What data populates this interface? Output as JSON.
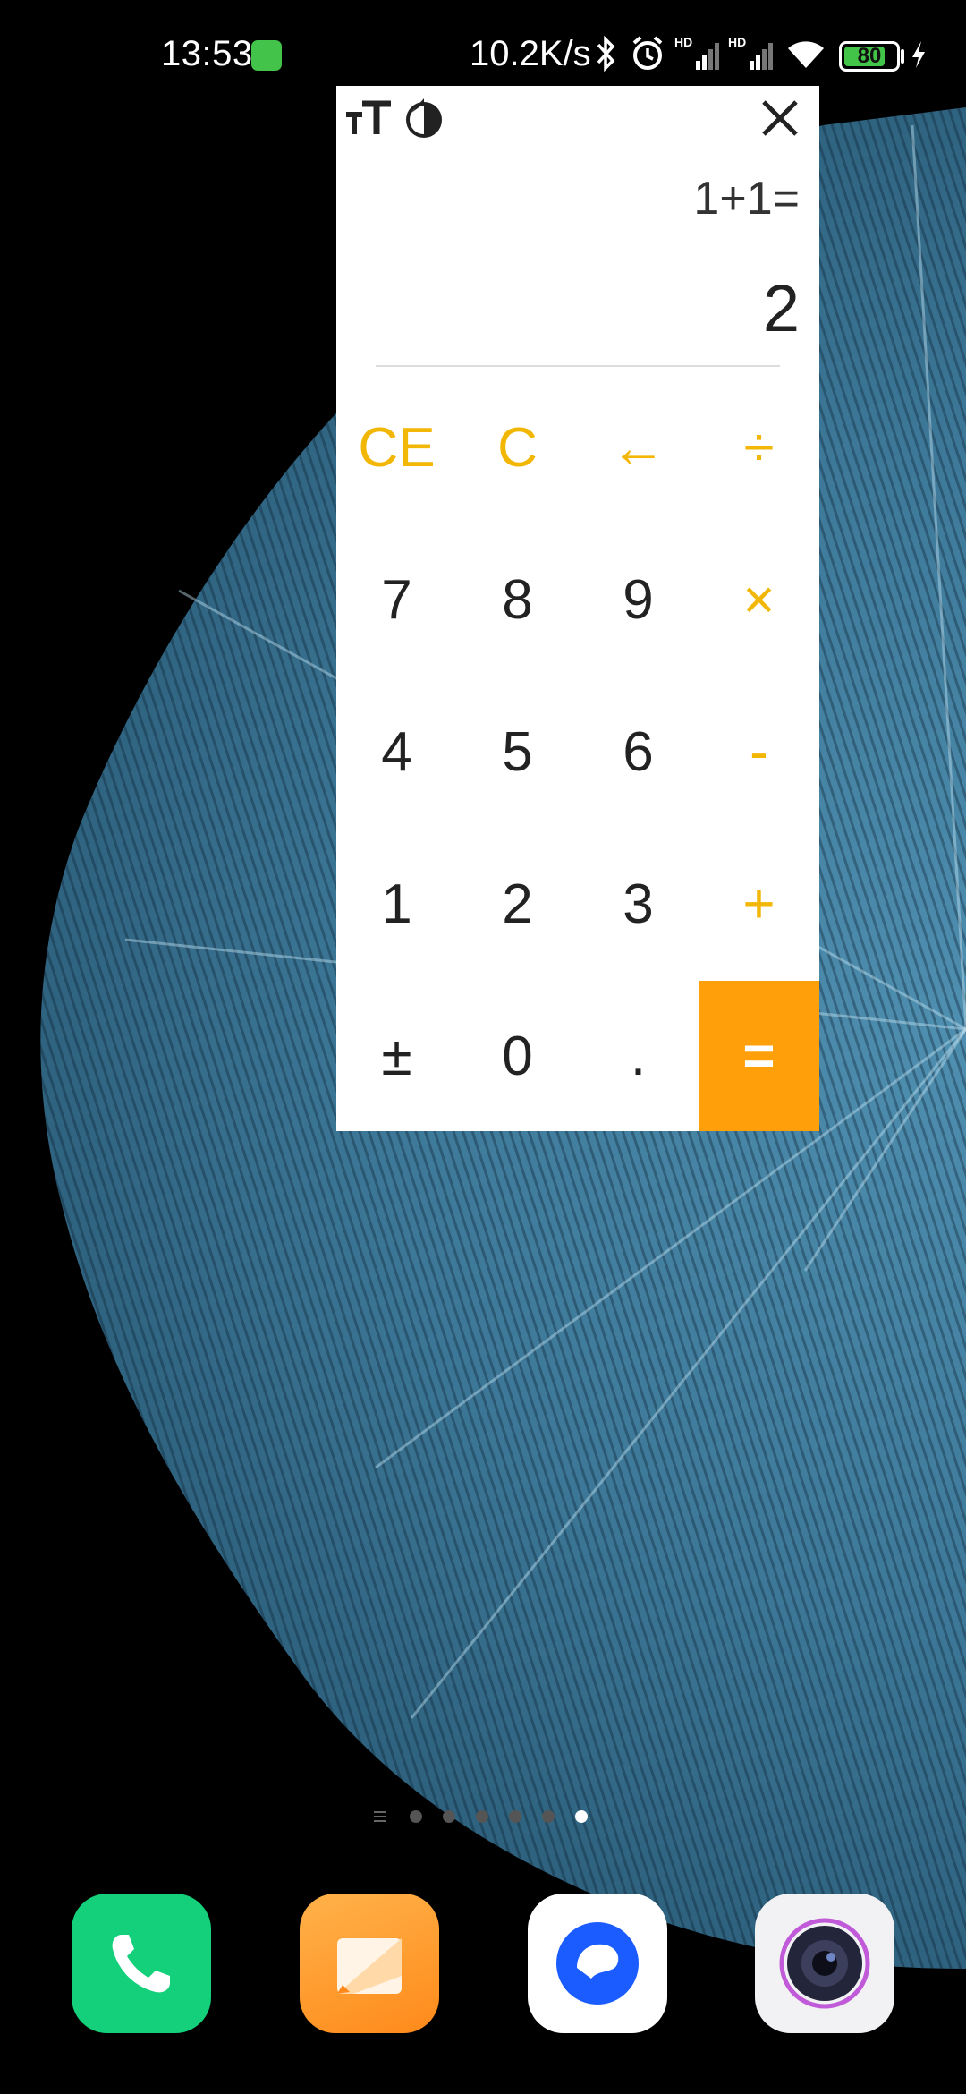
{
  "status_bar": {
    "time": "13:53",
    "net_speed": "10.2K/s",
    "battery_level": "80",
    "battery_fraction": 0.8,
    "icons": [
      "app-badge-icon",
      "bluetooth-icon",
      "alarm-icon",
      "signal-hd-icon",
      "signal-hd-icon",
      "wifi-icon",
      "battery-icon",
      "charging-icon"
    ]
  },
  "calculator": {
    "expression": "1+1=",
    "result": "2",
    "toolbar": {
      "text_size_icon": "text-size-icon",
      "theme_icon": "contrast-icon",
      "close_icon": "close-icon"
    },
    "keys": {
      "ce": "CE",
      "c": "C",
      "backspace": "←",
      "divide": "÷",
      "seven": "7",
      "eight": "8",
      "nine": "9",
      "multiply": "×",
      "four": "4",
      "five": "5",
      "six": "6",
      "minus": "-",
      "one": "1",
      "two": "2",
      "three": "3",
      "plus": "+",
      "plusminus": "±",
      "zero": "0",
      "dot": ".",
      "equals": "="
    },
    "accent_color": "#f2b705",
    "equals_color": "#ff9f0a"
  },
  "home_screen": {
    "page_count": 6,
    "active_page": 6,
    "dock": [
      "phone-app-icon",
      "notes-app-icon",
      "browser-app-icon",
      "camera-app-icon"
    ]
  }
}
